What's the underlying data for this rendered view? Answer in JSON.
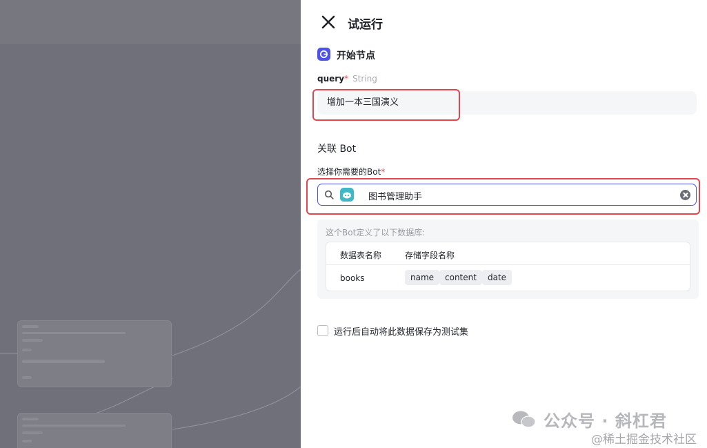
{
  "panel": {
    "title": "试运行",
    "start_node": {
      "label": "开始节点"
    },
    "query": {
      "label": "query",
      "required_mark": "*",
      "type": "String",
      "value": "增加一本三国演义"
    },
    "bot_section": {
      "title": "关联 Bot",
      "select_label": "选择你需要的Bot",
      "required_mark": "*",
      "selected_bot": "图书管理助手",
      "db_hint": "这个Bot定义了以下数据库:",
      "columns": [
        "数据表名称",
        "存储字段名称"
      ],
      "rows": [
        {
          "table": "books",
          "fields": [
            "name",
            "content",
            "date"
          ]
        }
      ]
    },
    "save_checkbox": {
      "label": "运行后自动将此数据保存为测试集",
      "checked": false
    }
  },
  "watermark": {
    "line1": "公众号 · 斜杠君",
    "line2": "@稀土掘金技术社区"
  },
  "colors": {
    "accent": "#4d53e8",
    "highlight": "#e0474c"
  }
}
